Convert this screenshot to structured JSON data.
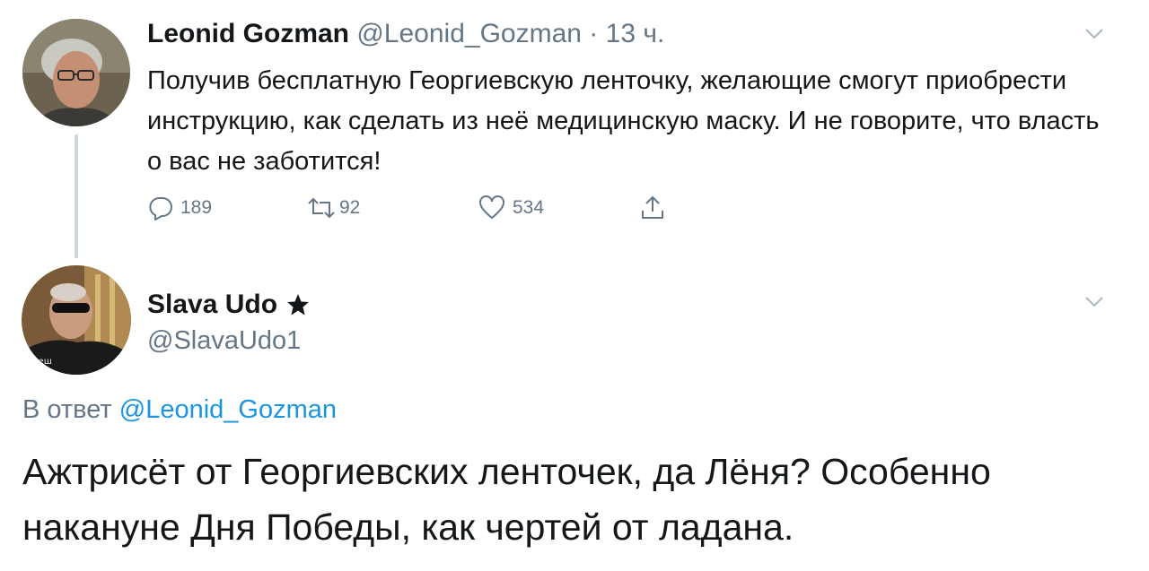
{
  "tweets": [
    {
      "name": "Leonid Gozman",
      "handle": "@Leonid_Gozman",
      "separator": "·",
      "time": "13 ч.",
      "text": "Получив бесплатную Георгиевскую ленточку, желающие смогут приобрести инструкцию, как сделать из неё медицинскую маску. И не говорите, что власть о вас не заботится!",
      "actions": {
        "replies": "189",
        "retweets": "92",
        "likes": "534"
      },
      "icons": {
        "reply": "reply-icon",
        "retweet": "retweet-icon",
        "like": "heart-icon",
        "share": "share-icon",
        "menu": "chevron-down-icon"
      }
    },
    {
      "name": "Slava Udo",
      "handle": "@SlavaUdo1",
      "reply_prefix": "В ответ",
      "reply_to": "@Leonid_Gozman",
      "text": "Ажтрисёт от Георгиевских ленточек, да Лёня? Особенно накануне Дня Победы, как чертей от ладана.",
      "icons": {
        "badge": "star-icon",
        "menu": "chevron-down-icon"
      }
    }
  ],
  "colors": {
    "text": "#14171a",
    "secondary": "#657786",
    "link": "#1b95e0",
    "thread": "#cfd9de"
  }
}
